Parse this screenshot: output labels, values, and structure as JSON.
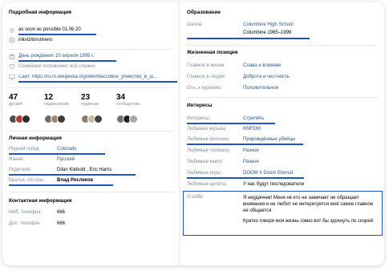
{
  "left": {
    "heading": "Подробная информация",
    "status_link": "as soon as possible 01.06.20",
    "nickname": "inkvizitorunivers",
    "birthday": "День рождения: 20 апреля 1999 г.",
    "family": "Семейное положение: всё сложно",
    "site": "Сайт: https://ru.m.wikipedia.org/wiki/Массовое_убийство_в_ш...",
    "counters": [
      {
        "value": "47",
        "label": "друзей"
      },
      {
        "value": "12",
        "label": "подписчиков"
      },
      {
        "value": "23",
        "label": "подписки"
      },
      {
        "value": "34",
        "label": "сообщества"
      }
    ],
    "personal": {
      "heading": "Личная информация",
      "rows": [
        {
          "label": "Родной город:",
          "value": "Colorado"
        },
        {
          "label": "Языки:",
          "value": "Русский"
        },
        {
          "label": "Родители:",
          "value": "Dilan Klebold , Eric Harris"
        },
        {
          "label": "Братья, сёстры:",
          "value": "Влад Рослеков"
        }
      ]
    },
    "contacts": {
      "heading": "Контактная информация",
      "rows": [
        {
          "label": "Моб. телефон:",
          "value": "666"
        },
        {
          "label": "Доп. телефон:",
          "value": "666"
        }
      ]
    }
  },
  "right": {
    "education": {
      "heading": "Образование",
      "label": "Школа:",
      "school": "Columbine High School",
      "years": "Columbine 1985–1999"
    },
    "position": {
      "heading": "Жизненная позиция",
      "rows": [
        {
          "label": "Главное в жизни:",
          "value": "Слава и влияние"
        },
        {
          "label": "Главное в людях:",
          "value": "Доброта и честность"
        },
        {
          "label": "Отн. к курению:",
          "value": "Положительное"
        }
      ]
    },
    "interests": {
      "heading": "Интересы",
      "rows": [
        {
          "label": "Интересы:",
          "value": "Стрелять"
        },
        {
          "label": "Любимая музыка:",
          "value": "KMFDM"
        },
        {
          "label": "Любимые фильмы:",
          "value": "Прирождённые убийцы"
        },
        {
          "label": "Любимые телешоу:",
          "value": "Разное"
        },
        {
          "label": "Любимые книги:",
          "value": "Разное"
        },
        {
          "label": "Любимые игры:",
          "value": "DOOM II Doom Eternal"
        },
        {
          "label": "Любимые цитаты:",
          "value": "У нас будут последователи"
        }
      ],
      "about_label": "О себе:",
      "about_p1": "Я неудачник! Меня не кто не замечает не обращает внимания и не любит не интересуется моё самое главное не общается",
      "about_p2": "Кратко говоря моя жизнь-говно вот бы здохнуть по скорей"
    }
  },
  "colors": {
    "accent": "#1e54c8",
    "link": "#2a5885",
    "muted": "#818c99"
  }
}
